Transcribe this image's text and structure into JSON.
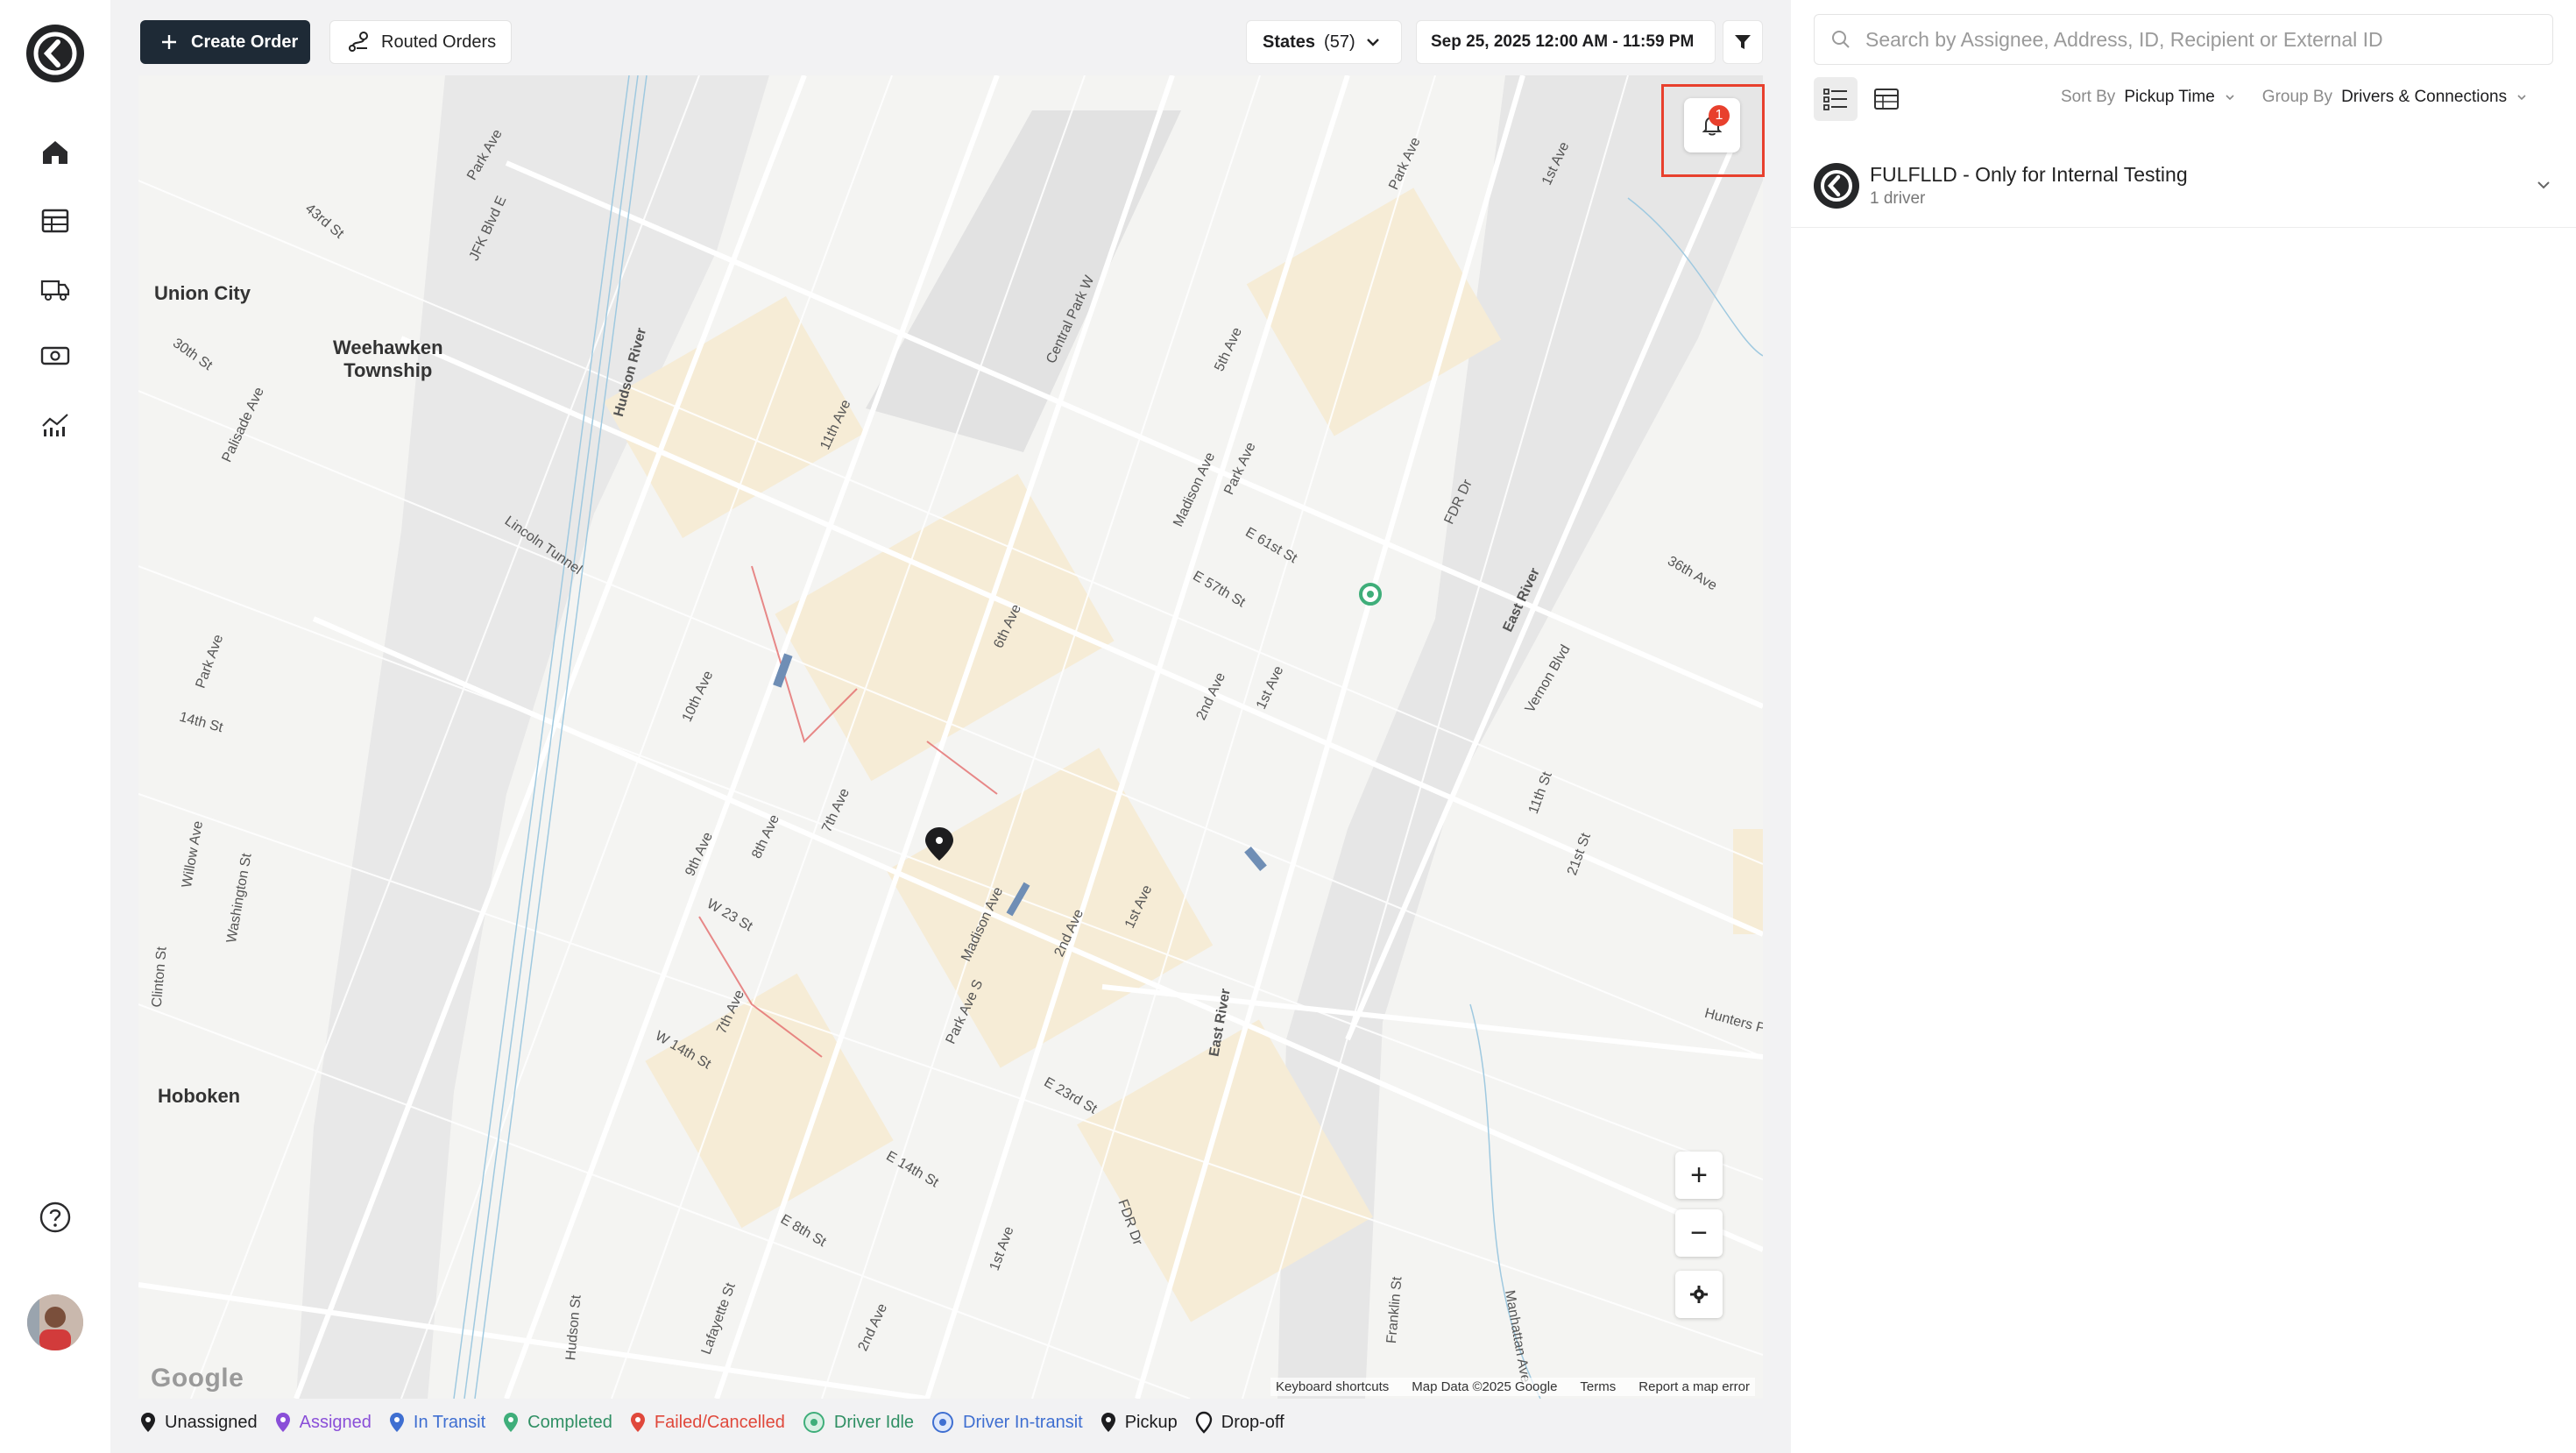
{
  "toolbar": {
    "create_order_label": "Create Order",
    "routed_orders_label": "Routed Orders",
    "states_label": "States",
    "states_count": "(57)",
    "date_range": "Sep 25, 2025 12:00 AM - 11:59 PM"
  },
  "nav": {
    "items": [
      "home-icon",
      "table-icon",
      "truck-icon",
      "money-icon",
      "analytics-icon"
    ],
    "help_icon": "help-icon"
  },
  "map": {
    "places": {
      "union_city": "Union City",
      "weehawken": "Weehawken\nTownship",
      "hoboken": "Hoboken"
    },
    "streets": {
      "s1": "Park Ave",
      "s2": "43rd St",
      "s3": "JFK Blvd E",
      "s4": "30th St",
      "s5": "Palisade Ave",
      "s6": "Hudson River",
      "s7": "11th Ave",
      "s8": "Central Park W",
      "s9": "5th Ave",
      "s10": "Park Ave",
      "s11": "1st Ave",
      "s12": "Lincoln Tunnel",
      "s13": "Madison Ave",
      "s14": "Park Ave",
      "s15": "E 61st St",
      "s16": "E 57th St",
      "s17": "FDR Dr",
      "s18": "East River",
      "s19": "36th Ave",
      "s20": "Vernon Blvd",
      "s21": "6th Ave",
      "s22": "Park Ave",
      "s23": "14th St",
      "s24": "10th Ave",
      "s25": "2nd Ave",
      "s26": "1st Ave",
      "s27": "11th St",
      "s28": "21st St",
      "s29": "Willow Ave",
      "s30": "Washington St",
      "s31": "9th Ave",
      "s32": "8th Ave",
      "s33": "7th Ave",
      "s34": "W 23 St",
      "s35": "Madison Ave",
      "s36": "2nd Ave",
      "s37": "1st Ave",
      "s38": "Clinton St",
      "s39": "Park Ave S",
      "s40": "7th Ave",
      "s41": "W 14th St",
      "s42": "East River",
      "s43": "Hunters Point",
      "s44": "E 23rd St",
      "s45": "E 14th St",
      "s46": "E 8th St",
      "s47": "FDR Dr",
      "s48": "1st Ave",
      "s49": "Hudson St",
      "s50": "Lafayette St",
      "s51": "2nd Ave",
      "s52": "Franklin St",
      "s53": "Manhattan Ave"
    },
    "notification_count": "1",
    "zoom_in": "+",
    "zoom_out": "−",
    "google": "Google",
    "attribution": {
      "keyboard": "Keyboard shortcuts",
      "data": "Map Data ©2025 Google",
      "terms": "Terms",
      "report": "Report a map error"
    }
  },
  "legend": {
    "unassigned": "Unassigned",
    "assigned": "Assigned",
    "in_transit": "In Transit",
    "completed": "Completed",
    "failed": "Failed/Cancelled",
    "driver_idle": "Driver Idle",
    "driver_transit": "Driver In-transit",
    "pickup": "Pickup",
    "dropoff": "Drop-off"
  },
  "colors": {
    "unassigned": "#1d1d1f",
    "assigned": "#8a4fd8",
    "in_transit": "#3f6fd1",
    "completed": "#3fae7a",
    "failed": "#e0483b",
    "driver_idle": "#3fae7a",
    "driver_transit": "#3f6fd1"
  },
  "panel": {
    "search_placeholder": "Search by Assignee, Address, ID, Recipient or External ID",
    "sort_by_label": "Sort By",
    "sort_by_value": "Pickup Time",
    "group_by_label": "Group By",
    "group_by_value": "Drivers & Connections",
    "group": {
      "title": "FULFLLD - Only for Internal Testing",
      "subtitle": "1 driver"
    }
  }
}
